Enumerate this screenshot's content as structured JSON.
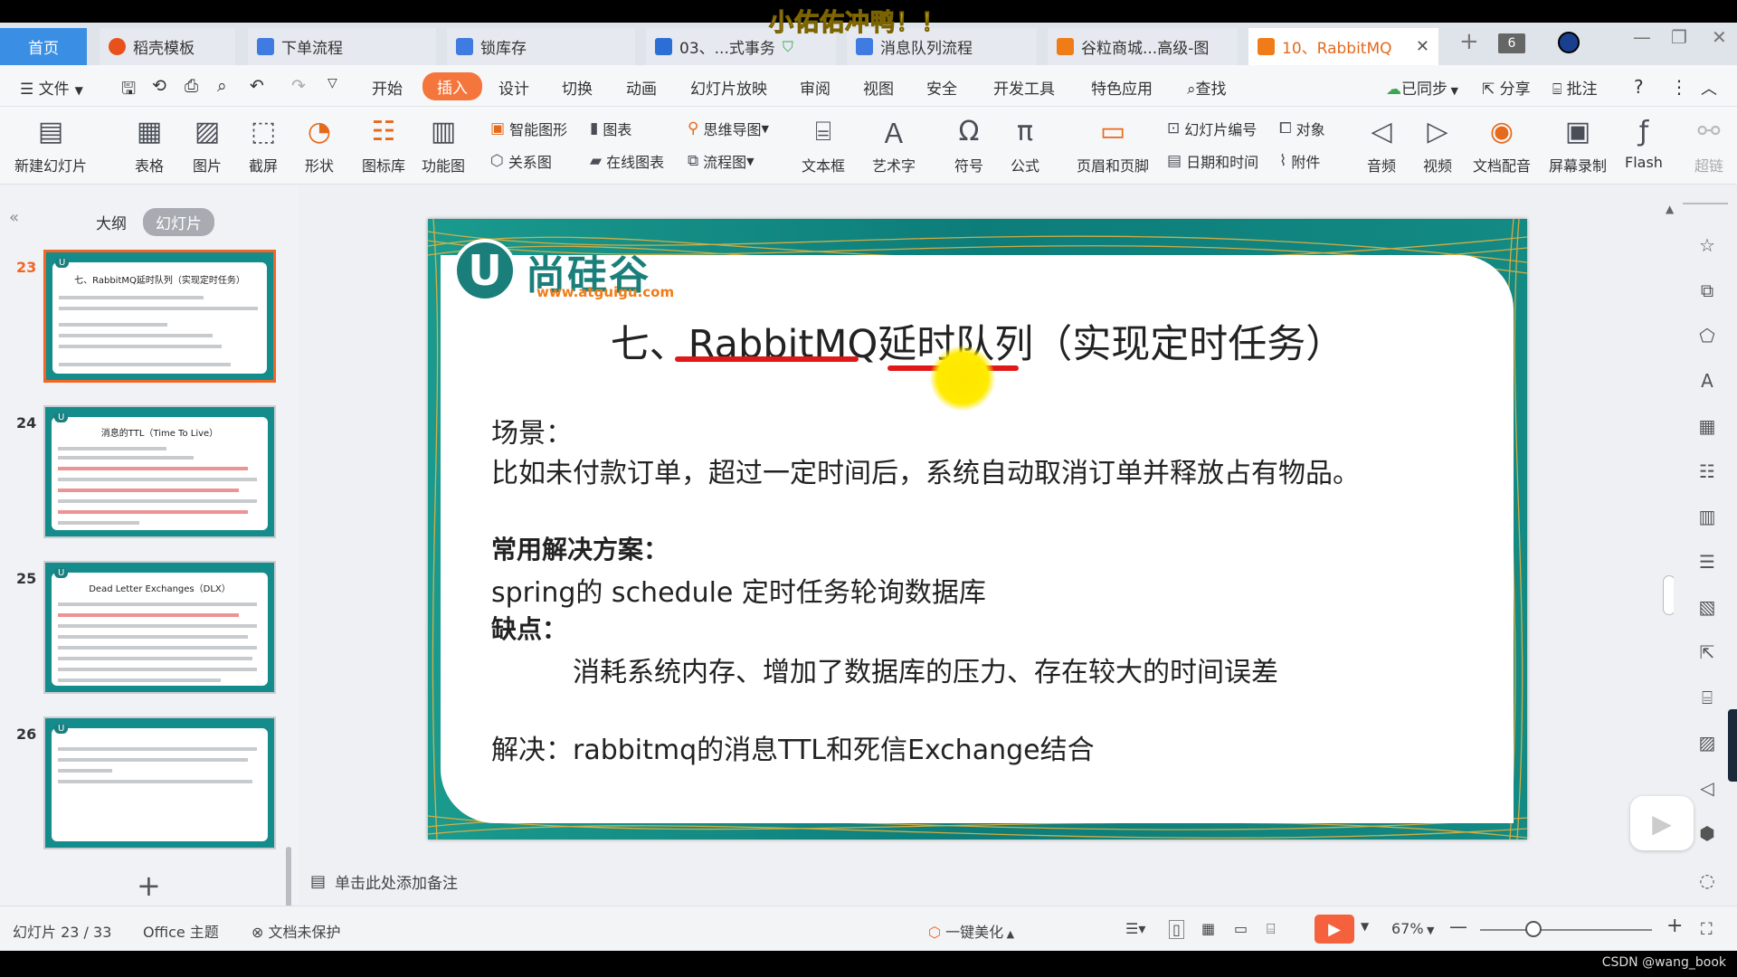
{
  "overlay": {
    "text": "小佑佑冲鸭！！"
  },
  "tabs": [
    {
      "label": "首页",
      "type": "home"
    },
    {
      "label": "稻壳模板",
      "color": "#e8501c"
    },
    {
      "label": "下单流程",
      "color": "#3f7be0"
    },
    {
      "label": "锁库存",
      "color": "#3f7be0"
    },
    {
      "label": "03、...式事务",
      "color": "#3f7be0"
    },
    {
      "label": "消息队列流程",
      "color": "#3f7be0"
    },
    {
      "label": "谷粒商城...高级-图",
      "color": "#f07c18"
    },
    {
      "label": "10、RabbitMQ",
      "color": "#f07c18",
      "active": true
    }
  ],
  "tabbar": {
    "count": "6"
  },
  "menubar": {
    "file": "文件",
    "items": [
      "开始",
      "插入",
      "设计",
      "切换",
      "动画",
      "幻灯片放映",
      "审阅",
      "视图",
      "安全",
      "开发工具",
      "特色应用"
    ],
    "search": "查找",
    "synced": "已同步",
    "share": "分享",
    "comment": "批注"
  },
  "ribbon": {
    "big": [
      "新建幻灯片",
      "表格",
      "图片",
      "截屏",
      "形状",
      "图标库",
      "功能图"
    ],
    "small_a": [
      "智能图形",
      "关系图"
    ],
    "small_b": [
      "图表",
      "在线图表"
    ],
    "small_c": [
      "思维导图",
      "流程图"
    ],
    "big2": [
      "文本框",
      "艺术字",
      "符号",
      "公式",
      "页眉和页脚"
    ],
    "small_d": [
      "幻灯片编号",
      "日期和时间"
    ],
    "small_e": [
      "对象",
      "附件"
    ],
    "big3": [
      "音频",
      "视频",
      "文档配音",
      "屏幕录制",
      "Flash",
      "超链"
    ]
  },
  "panel": {
    "outline": "大纲",
    "slides": "幻灯片"
  },
  "thumbnails": [
    {
      "num": "23",
      "title": "七、RabbitMQ延时队列（实现定时任务）",
      "selected": true
    },
    {
      "num": "24",
      "title": "消息的TTL（Time To Live）"
    },
    {
      "num": "25",
      "title": "Dead Letter Exchanges（DLX）"
    },
    {
      "num": "26",
      "title": ""
    }
  ],
  "slide": {
    "logo_text": "尚硅谷",
    "logo_url": "www.atguigu.com",
    "title": "七、RabbitMQ延时队列（实现定时任务）",
    "scene_label": "场景：",
    "scene_text": "比如未付款订单，超过一定时间后，系统自动取消订单并释放占有物品。",
    "solution_label": "常用解决方案：",
    "solution_text": "spring的 schedule 定时任务轮询数据库",
    "con_label": "缺点：",
    "con_text": "消耗系统内存、增加了数据库的压力、存在较大的时间误差",
    "resolve": "解决：rabbitmq的消息TTL和死信Exchange结合"
  },
  "notes": {
    "placeholder": "单击此处添加备注"
  },
  "status": {
    "slide_pos": "幻灯片 23 / 33",
    "theme": "Office 主题",
    "protect": "文档未保护",
    "beautify": "一键美化",
    "zoom": "67%"
  },
  "watermark": "CSDN @wang_book",
  "colors": {
    "accent": "#f5763d",
    "teal": "#0f8a86",
    "underline": "#e01818"
  }
}
